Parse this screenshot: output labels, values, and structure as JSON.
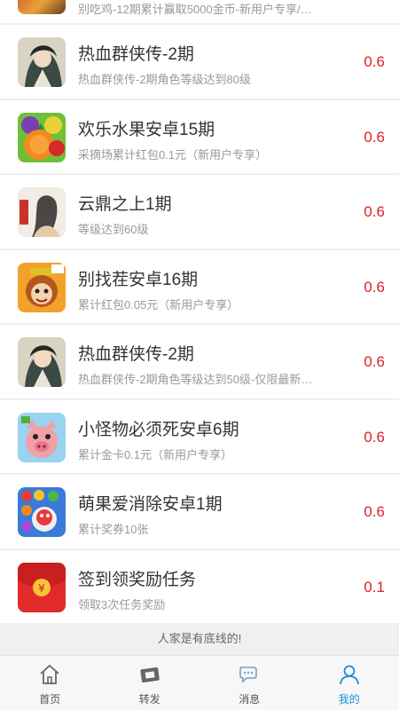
{
  "partial_item": {
    "subtitle": "别吃鸡-12期累计赢取5000金币-新用户专享/…"
  },
  "items": [
    {
      "title": "热血群侠传-2期",
      "subtitle": "热血群侠传-2期角色等级达到80级",
      "reward": "0.6",
      "icon": "game-art-icon"
    },
    {
      "title": "欢乐水果安卓15期",
      "subtitle": "采摘场累计红包0.1元（新用户专享）",
      "reward": "0.6",
      "icon": "fruit-game-icon"
    },
    {
      "title": "云鼎之上1期",
      "subtitle": "等级达到60级",
      "reward": "0.6",
      "icon": "game-art-icon"
    },
    {
      "title": "别找茬安卓16期",
      "subtitle": "累计红包0.05元（新用户专享）",
      "reward": "0.6",
      "icon": "monkey-game-icon"
    },
    {
      "title": "热血群侠传-2期",
      "subtitle": "热血群侠传-2期角色等级达到50级-仅限最新…",
      "reward": "0.6",
      "icon": "game-art-icon"
    },
    {
      "title": "小怪物必须死安卓6期",
      "subtitle": "累计金卡0.1元（新用户专享）",
      "reward": "0.6",
      "icon": "pig-game-icon"
    },
    {
      "title": "萌果爱消除安卓1期",
      "subtitle": "累计奖券10张",
      "reward": "0.6",
      "icon": "match-game-icon"
    },
    {
      "title": "签到领奖励任务",
      "subtitle": "领取3次任务奖励",
      "reward": "0.1",
      "icon": "red-envelope-icon"
    }
  ],
  "slogan": "人家是有底线的!",
  "tabs": [
    {
      "label": "首页",
      "icon": "home-icon"
    },
    {
      "label": "转发",
      "icon": "share-ticket-icon"
    },
    {
      "label": "消息",
      "icon": "message-icon"
    },
    {
      "label": "我的",
      "icon": "user-icon",
      "active": true
    }
  ],
  "colors": {
    "reward": "#e02020",
    "active_tab": "#1a8ed8",
    "divider": "#eeeeee"
  }
}
